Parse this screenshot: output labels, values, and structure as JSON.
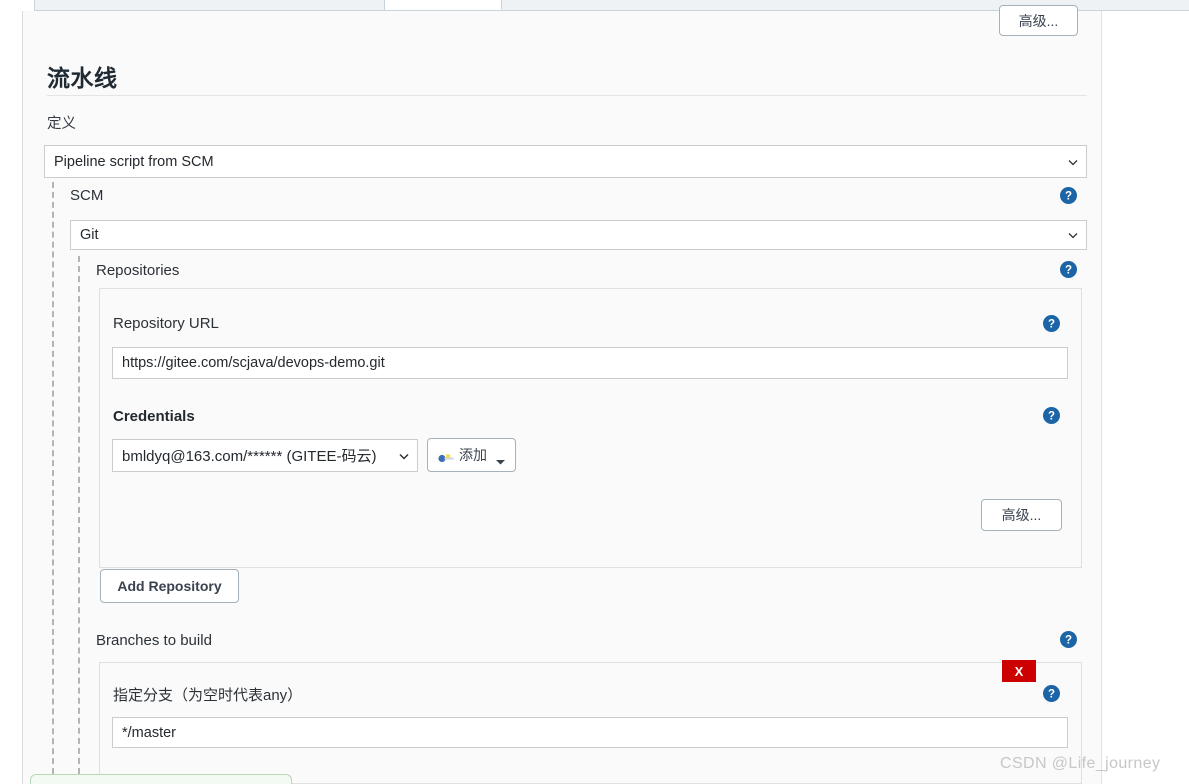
{
  "window": {
    "tabs": [
      {
        "label": "",
        "active": false
      },
      {
        "label": "",
        "active": true
      },
      {
        "label": "",
        "active": false
      }
    ]
  },
  "toolbar": {
    "advanced_top_label": "高级..."
  },
  "section": {
    "title": "流水线",
    "definition_label": "定义",
    "definition_value": "Pipeline script from SCM"
  },
  "scm": {
    "label": "SCM",
    "value": "Git",
    "help_icon": "help-icon",
    "repositories": {
      "label": "Repositories",
      "help_icon": "help-icon",
      "repository_url": {
        "label": "Repository URL",
        "value": "https://gitee.com/scjava/devops-demo.git",
        "help_icon": "help-icon"
      },
      "credentials": {
        "label": "Credentials",
        "value": "bmldyq@163.com/****** (GITEE-码云)",
        "add_button_label": "添加",
        "add_button_icon": "key-icon",
        "help_icon": "help-icon"
      },
      "advanced_label": "高级...",
      "add_repository_label": "Add Repository"
    },
    "branches": {
      "label": "Branches to build",
      "help_icon": "help-icon",
      "delete_label": "X",
      "branch_specifier_label": "指定分支（为空时代表any）",
      "branch_specifier_value": "*/master",
      "help_icon_spec": "help-icon"
    }
  },
  "watermark": {
    "text": "CSDN @Life_journey"
  },
  "colors": {
    "help_blue": "#1b64a5",
    "delete_red": "#cc0000",
    "panel_bg": "#fafafa",
    "page_bg": "#ffffff"
  }
}
